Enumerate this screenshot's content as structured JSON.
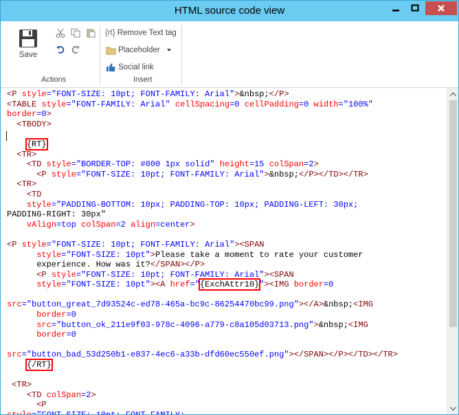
{
  "window": {
    "title": "HTML source code view"
  },
  "ribbon": {
    "save_label": "Save",
    "actions_group": "Actions",
    "insert_group": "Insert",
    "remove_text_tag_label": "Remove Text tag",
    "placeholder_label": "Placeholder",
    "social_link_label": "Social link",
    "icons": [
      "save-icon",
      "cut-icon",
      "copy-icon",
      "paste-icon",
      "undo-icon",
      "redo-icon",
      "text-tag-icon",
      "folder-icon",
      "thumbs-up-icon"
    ]
  },
  "code": {
    "lines": [
      "<P style=\"FONT-SIZE: 10pt; FONT-FAMILY: Arial\">&nbsp;</P>",
      "<TABLE style=\"FONT-FAMILY: Arial\" cellSpacing=0 cellPadding=0 width=\"100%\"",
      "border=0>",
      "  <TBODY>",
      "",
      "    {RT}",
      "  <TR>",
      "    <TD style=\"BORDER-TOP: #000 1px solid\" height=15 colSpan=2>",
      "      <P style=\"FONT-SIZE: 10pt; FONT-FAMILY: Arial\">&nbsp;</P></TD></TR>",
      "  <TR>",
      "    <TD",
      "    style=\"PADDING-BOTTOM: 10px; PADDING-TOP: 10px; PADDING-LEFT: 30px;",
      "PADDING-RIGHT: 30px\"",
      "    vAlign=top colSpan=2 align=center>",
      "",
      "<P style=\"FONT-SIZE: 10pt; FONT-FAMILY: Arial\"><SPAN",
      "      style=\"FONT-SIZE: 10pt\">Please take a moment to rate your customer",
      "      experience. How was it?</SPAN></P>",
      "      <P style=\"FONT-SIZE: 10pt; FONT-FAMILY: Arial\"><SPAN",
      "      style=\"FONT-SIZE: 10pt\"><A href=\"{ExchAttr10}\"><IMG border=0",
      "",
      "src=\"button_great_7d93524c-ed78-465a-bc9c-86254470bc99.png\"></A>&nbsp;<IMG",
      "      border=0",
      "      src=\"button_ok_211e9f03-978c-4096-a779-c8a105d03713.png\">&nbsp;<IMG",
      "      border=0",
      "",
      "src=\"button_bad_53d250b1-e837-4ec6-a33b-dfd60ec550ef.png\"></SPAN></P></TD></TR>",
      "    {/RT}",
      "",
      " <TR>",
      "    <TD colSpan=2>",
      "      <P",
      "style=\"FONT-SIZE: 10pt; FONT-FAMILY:"
    ]
  }
}
